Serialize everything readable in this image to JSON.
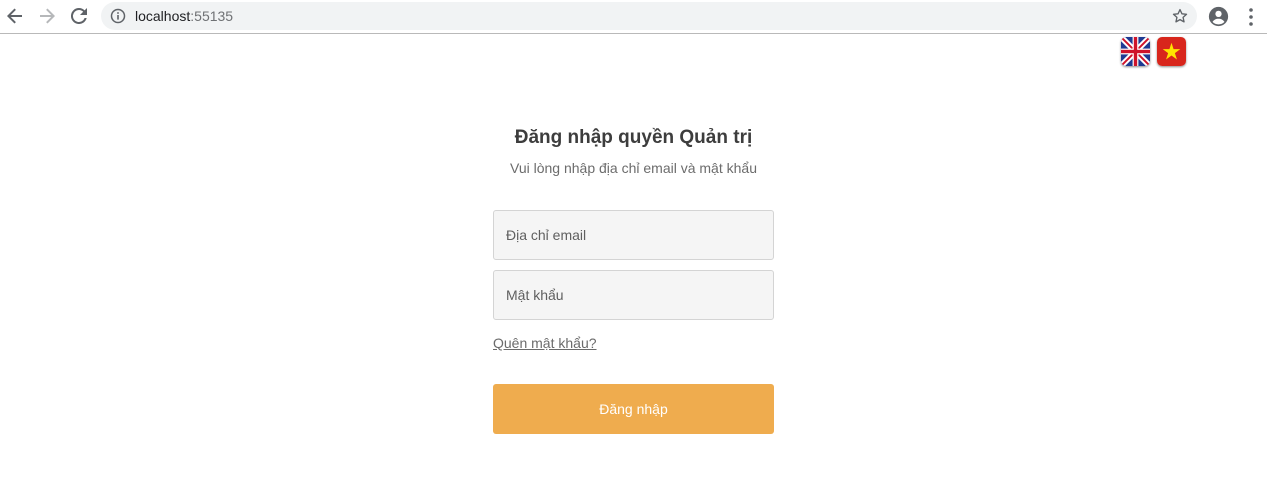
{
  "browser": {
    "url_host": "localhost",
    "url_port": ":55135",
    "icons": {
      "back": "arrow-left-icon",
      "forward": "arrow-right-icon",
      "reload": "reload-icon",
      "info": "info-icon",
      "bookmark": "star-icon",
      "profile": "account-circle-icon",
      "menu": "more-vert-icon"
    }
  },
  "languages": [
    {
      "code": "en",
      "icon": "uk-flag-icon"
    },
    {
      "code": "vi",
      "icon": "vietnam-flag-icon"
    }
  ],
  "login": {
    "title": "Đăng nhập quyền Quản trị",
    "subtitle": "Vui lòng nhập địa chỉ email và mật khẩu",
    "email_placeholder": "Địa chỉ email",
    "password_placeholder": "Mật khẩu",
    "forgot_password": "Quên mật khẩu?",
    "submit_label": "Đăng nhập"
  },
  "colors": {
    "primary_button": "#efac4e",
    "input_background": "#f5f5f5",
    "omnibox_background": "#f1f3f4"
  }
}
